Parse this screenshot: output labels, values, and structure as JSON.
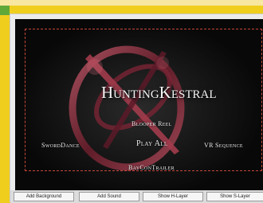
{
  "dvd_menu": {
    "title": "HuntingKestral",
    "items": {
      "blooper_reel": "Blooper Reel",
      "sword_dance": "SwordDance",
      "play_all": "Play All",
      "vr_sequence": "VR Sequence",
      "baycon_trailer": "BayConTrailer"
    }
  },
  "toolbar": {
    "add_background": "Add Background",
    "add_sound": "Add Sound",
    "show_h_layer": "Show H-Layer",
    "show_s_layer": "Show S-Layer"
  },
  "colors": {
    "window_bg": "#f0ce1e",
    "safe_frame": "#c8463a",
    "ring": "#8a2a3a"
  }
}
